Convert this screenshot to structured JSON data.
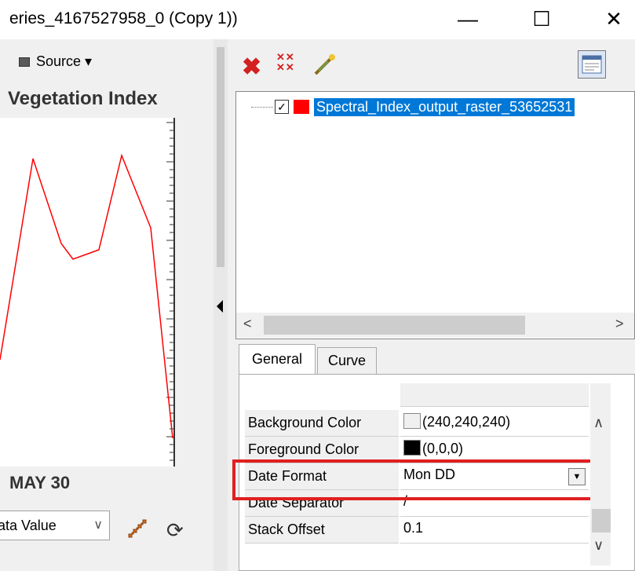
{
  "window": {
    "title": "eries_4167527958_0 (Copy 1))",
    "controls": {
      "minimize": "—",
      "maximize": "☐",
      "close": "✕"
    }
  },
  "chart_panel": {
    "source_label": "Source ▾",
    "title": "Vegetation Index",
    "x_tick_label": "MAY 30",
    "value_select": "ata Value",
    "line_color": "#ff0000"
  },
  "chart_data": {
    "type": "line",
    "title": "Vegetation Index",
    "xlabel": "",
    "ylabel": "",
    "x_tick_labels": [
      "MAY 30"
    ],
    "series": [
      {
        "values": [
          0.28,
          0.92,
          0.65,
          0.6,
          0.63,
          0.93,
          0.7,
          0.03
        ]
      }
    ],
    "grid": false
  },
  "right_panel": {
    "toolbar": {
      "delete_icon": "delete-icon",
      "delete_all_icon": "delete-all-icon",
      "edit_icon": "wand-icon",
      "properties_icon": "properties-icon"
    },
    "tree": {
      "item_label": "Spectral_Index_output_raster_53652531",
      "item_checked": true,
      "item_color": "#ff0000"
    },
    "tabs": [
      {
        "label": "General"
      },
      {
        "label": "Curve"
      }
    ],
    "properties": {
      "background_color": {
        "name": "Background Color",
        "value": "(240,240,240)",
        "swatch": "#f0f0f0"
      },
      "foreground_color": {
        "name": "Foreground Color",
        "value": "(0,0,0)",
        "swatch": "#000000"
      },
      "date_format": {
        "name": "Date Format",
        "value": "Mon DD"
      },
      "date_separator": {
        "name": "Date Separator",
        "value": "/"
      },
      "stack_offset": {
        "name": "Stack Offset",
        "value": "0.1"
      }
    },
    "highlight_color": "#e02020"
  }
}
